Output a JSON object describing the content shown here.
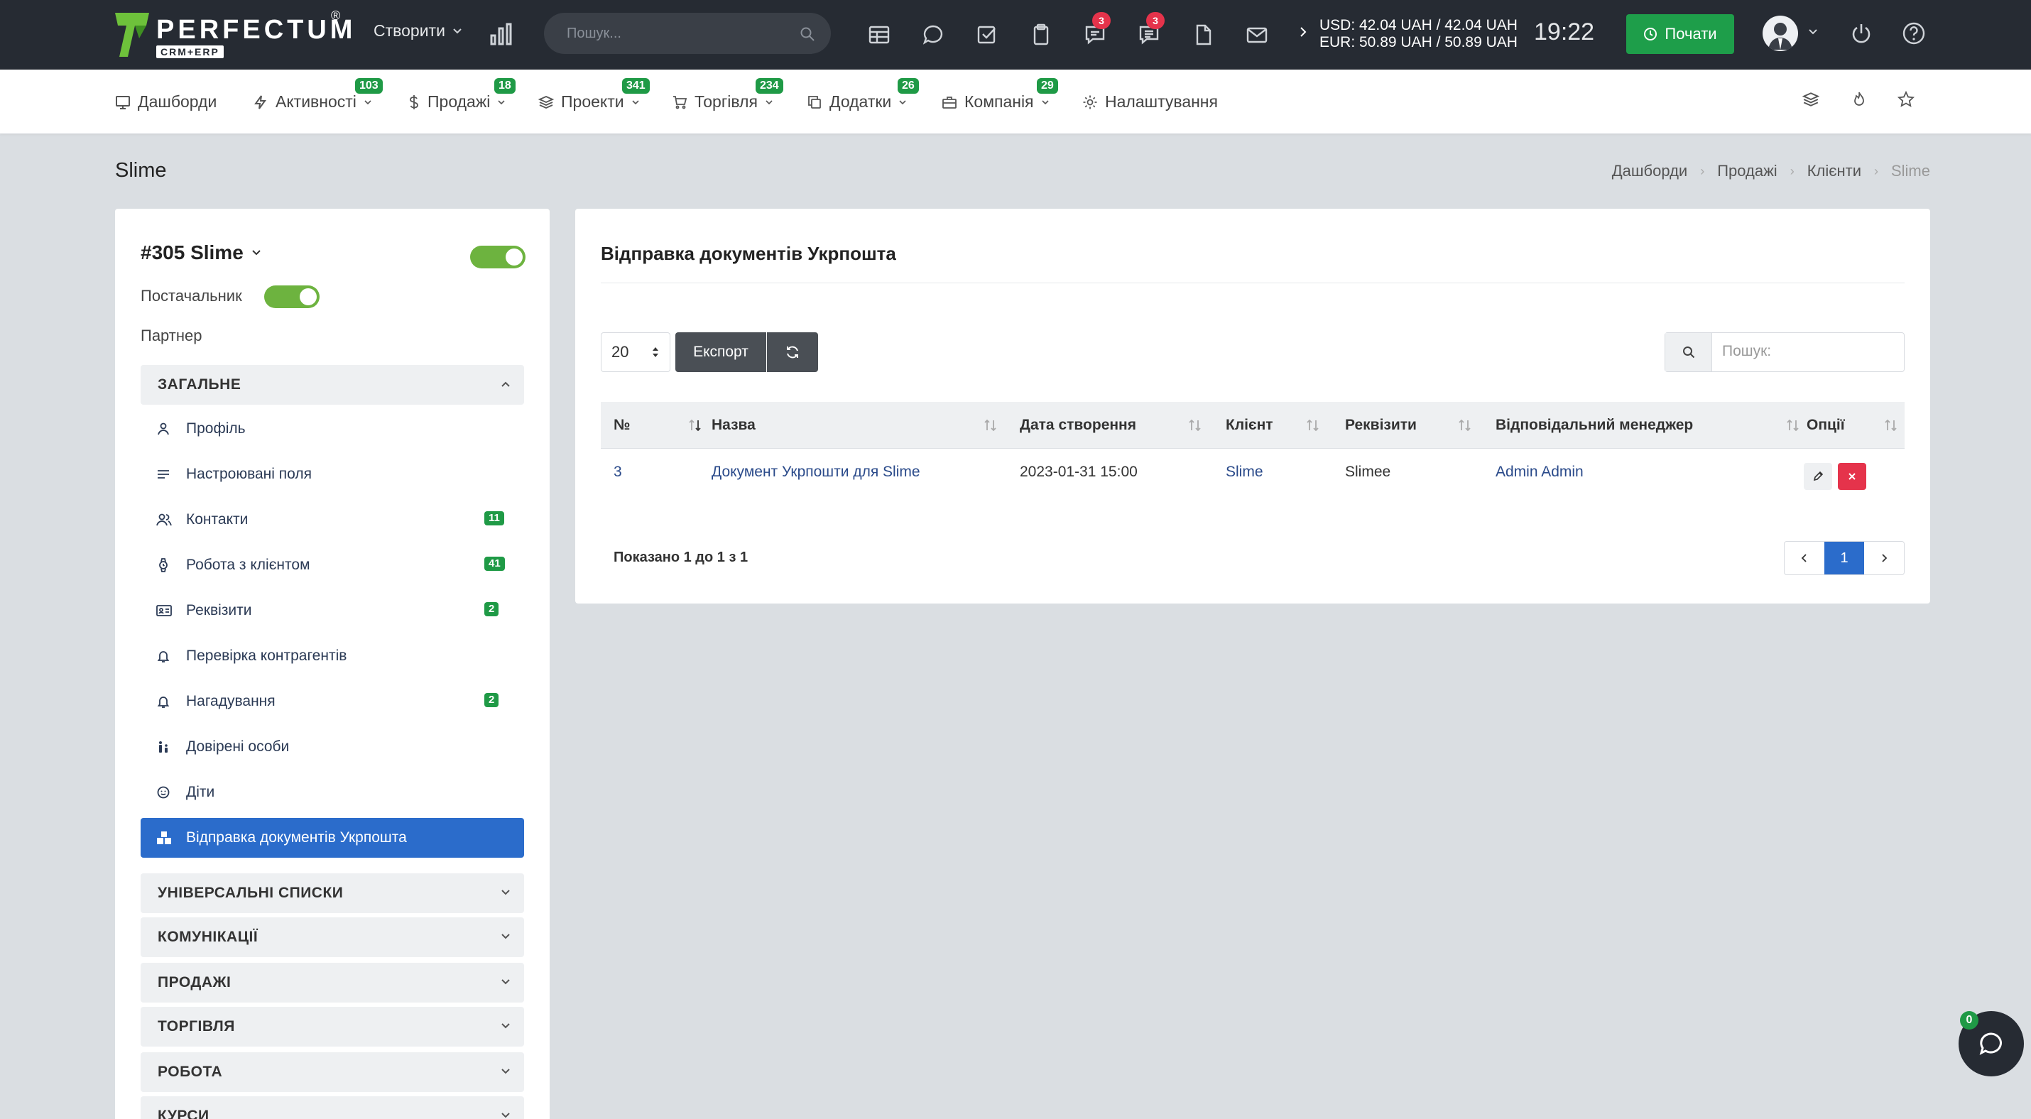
{
  "app": {
    "logo_word": "PERFECTUM",
    "logo_sub": "CRM+ERP",
    "logo_reg": "®"
  },
  "topbar": {
    "create_label": "Створити",
    "search_placeholder": "Пошук...",
    "badges": {
      "chat": "3",
      "messages": "3"
    },
    "currency_usd": "USD: 42.04 UAH / 42.04 UAH",
    "currency_eur": "EUR: 50.89 UAH / 50.89 UAH",
    "clock": "19:22",
    "start_label": "Почати"
  },
  "nav": {
    "items": [
      {
        "label": "Дашборди",
        "badge": ""
      },
      {
        "label": "Активності",
        "badge": "103"
      },
      {
        "label": "Продажі",
        "badge": "18"
      },
      {
        "label": "Проекти",
        "badge": "341"
      },
      {
        "label": "Торгівля",
        "badge": "234"
      },
      {
        "label": "Додатки",
        "badge": "26"
      },
      {
        "label": "Компанія",
        "badge": "29"
      },
      {
        "label": "Налаштування",
        "badge": ""
      }
    ]
  },
  "page": {
    "title": "Slime",
    "breadcrumb": [
      "Дашборди",
      "Продажі",
      "Клієнти",
      "Slime"
    ]
  },
  "client": {
    "title": "#305 Slime",
    "supplier_label": "Постачальник",
    "partner_label": "Партнер",
    "section_general": "ЗАГАЛЬНЕ",
    "menu": [
      {
        "label": "Профіль",
        "badge": ""
      },
      {
        "label": "Настроювані поля",
        "badge": ""
      },
      {
        "label": "Контакти",
        "badge": "11"
      },
      {
        "label": "Робота з клієнтом",
        "badge": "41"
      },
      {
        "label": "Реквізити",
        "badge": "2"
      },
      {
        "label": "Перевірка контрагентів",
        "badge": ""
      },
      {
        "label": "Нагадування",
        "badge": "2"
      },
      {
        "label": "Довірені особи",
        "badge": ""
      },
      {
        "label": "Діти",
        "badge": ""
      },
      {
        "label": "Відправка документів Укрпошта",
        "badge": ""
      }
    ],
    "sections": [
      "УНІВЕРСАЛЬНІ СПИСКИ",
      "КОМУНІКАЦІЇ",
      "ПРОДАЖІ",
      "ТОРГІВЛЯ",
      "РОБОТА",
      "КУРСИ"
    ]
  },
  "card": {
    "title": "Відправка документів Укрпошта",
    "page_length": "20",
    "export_label": "Експорт",
    "search_placeholder": "Пошук:",
    "columns": [
      "№",
      "Назва",
      "Дата створення",
      "Клієнт",
      "Реквізити",
      "Відповідальний менеджер",
      "Опції"
    ],
    "rows": [
      {
        "num": "3",
        "name": "Документ Укрпошти для Slime",
        "date": "2023-01-31 15:00",
        "client": "Slime",
        "requisites": "Slimee",
        "manager": "Admin Admin"
      }
    ],
    "showing": "Показано 1 до 1 з 1",
    "current_page": "1"
  },
  "chat": {
    "badge": "0"
  },
  "colors": {
    "accent_green": "#1f9a46",
    "primary_blue": "#2b6ccb",
    "danger_red": "#e5334b",
    "dark": "#262b33"
  }
}
